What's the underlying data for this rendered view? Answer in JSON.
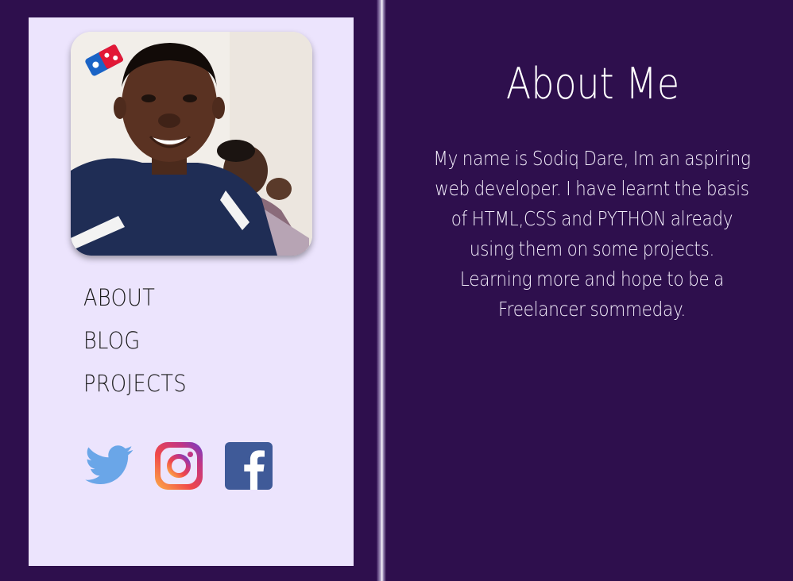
{
  "sidebar": {
    "nav": [
      {
        "label": "ABOUT"
      },
      {
        "label": "BLOG"
      },
      {
        "label": "PROJECTS"
      }
    ],
    "socials": [
      {
        "icon": "twitter-icon",
        "color": "#6aa6e8"
      },
      {
        "icon": "instagram-icon",
        "color": "#c13584"
      },
      {
        "icon": "facebook-icon",
        "color": "#3f5a98"
      }
    ]
  },
  "main": {
    "title": "About Me",
    "bio": "My name is Sodiq Dare, Im an aspiring web developer. I have learnt the basis of HTML,CSS and PYTHON already using them on some projects. Learning more and hope to be a Freelancer sommeday."
  },
  "colors": {
    "background": "#2e0f4d",
    "sidebar": "#ece4fd",
    "text_light": "#ffffff",
    "text_dark": "#1a1a1a"
  }
}
